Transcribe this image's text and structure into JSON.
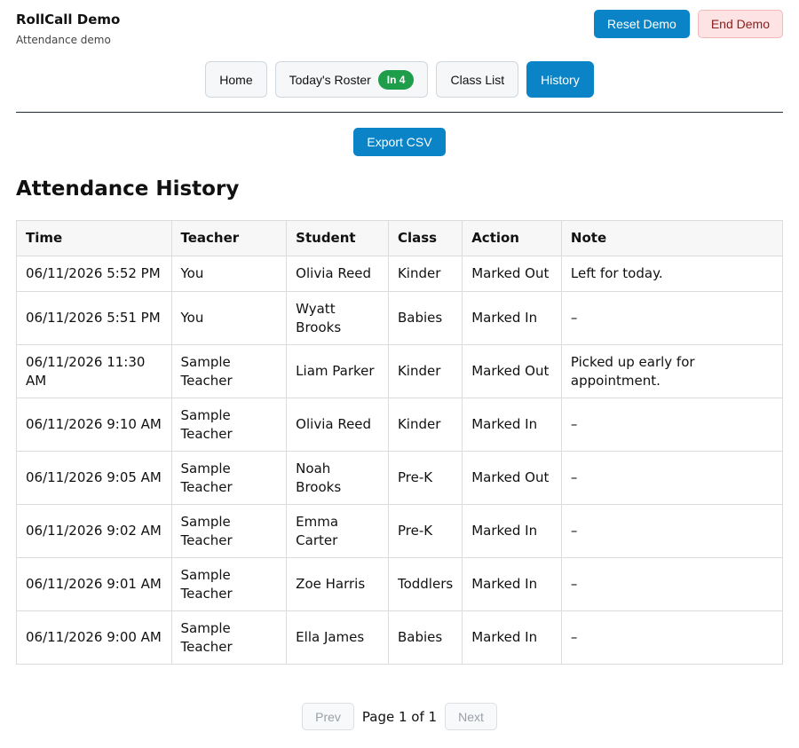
{
  "header": {
    "title": "RollCall Demo",
    "subtitle": "Attendance demo",
    "reset_label": "Reset Demo",
    "end_label": "End Demo"
  },
  "nav": {
    "home": "Home",
    "roster": "Today's Roster",
    "roster_badge": "In 4",
    "class_list": "Class List",
    "history": "History"
  },
  "export_label": "Export CSV",
  "page_title": "Attendance History",
  "table": {
    "headers": [
      "Time",
      "Teacher",
      "Student",
      "Class",
      "Action",
      "Note"
    ],
    "rows": [
      [
        "06/11/2026 5:52 PM",
        "You",
        "Olivia Reed",
        "Kinder",
        "Marked Out",
        "Left for today."
      ],
      [
        "06/11/2026 5:51 PM",
        "You",
        "Wyatt Brooks",
        "Babies",
        "Marked In",
        "–"
      ],
      [
        "06/11/2026 11:30 AM",
        "Sample Teacher",
        "Liam Parker",
        "Kinder",
        "Marked Out",
        "Picked up early for appointment."
      ],
      [
        "06/11/2026 9:10 AM",
        "Sample Teacher",
        "Olivia Reed",
        "Kinder",
        "Marked In",
        "–"
      ],
      [
        "06/11/2026 9:05 AM",
        "Sample Teacher",
        "Noah Brooks",
        "Pre-K",
        "Marked Out",
        "–"
      ],
      [
        "06/11/2026 9:02 AM",
        "Sample Teacher",
        "Emma Carter",
        "Pre-K",
        "Marked In",
        "–"
      ],
      [
        "06/11/2026 9:01 AM",
        "Sample Teacher",
        "Zoe Harris",
        "Toddlers",
        "Marked In",
        "–"
      ],
      [
        "06/11/2026 9:00 AM",
        "Sample Teacher",
        "Ella James",
        "Babies",
        "Marked In",
        "–"
      ]
    ]
  },
  "pagination": {
    "prev": "Prev",
    "label": "Page 1 of 1",
    "next": "Next"
  },
  "colors": {
    "primary": "#0a84c6",
    "badge": "#1e9e4a",
    "danger_bg": "#fde3e3",
    "danger_text": "#8b1d1d"
  }
}
